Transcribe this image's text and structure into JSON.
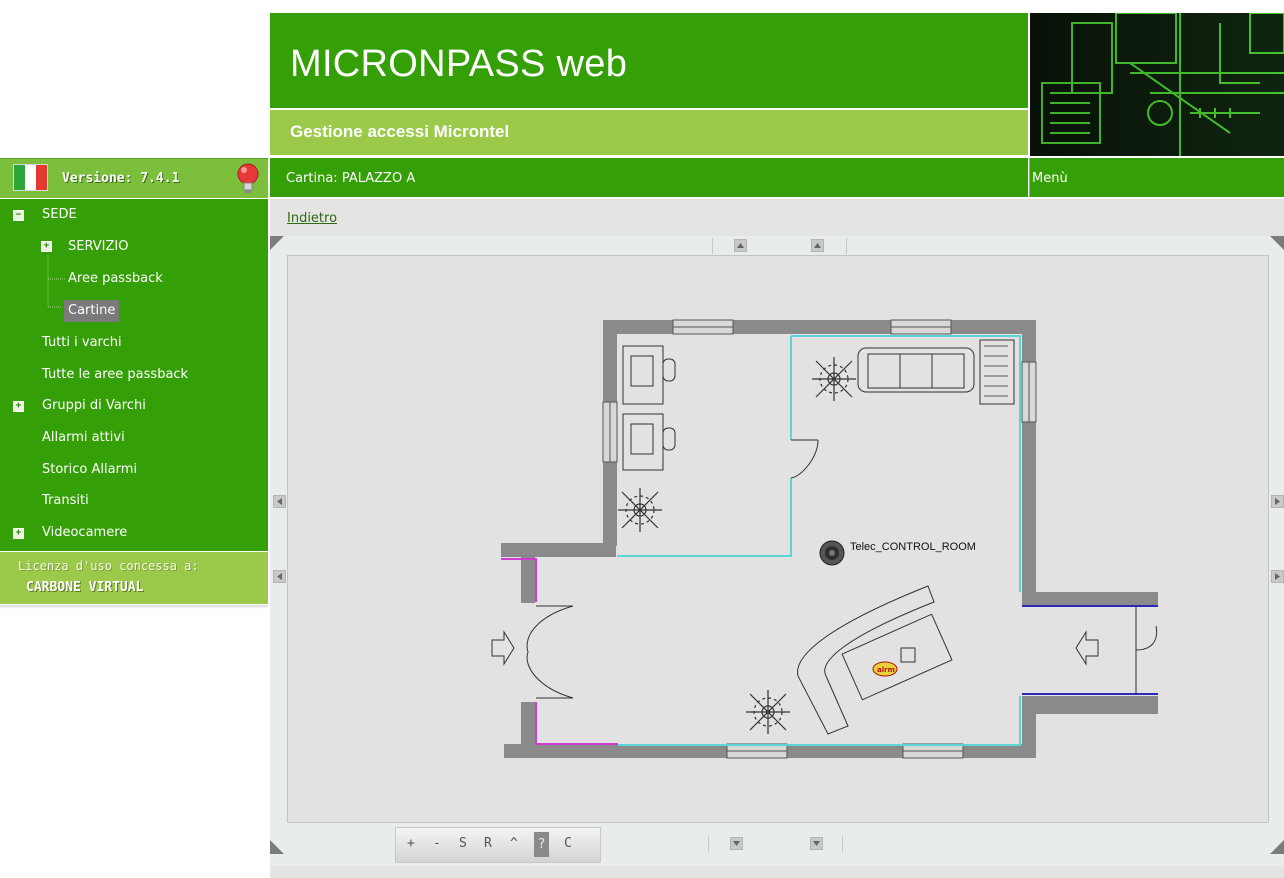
{
  "header": {
    "app_title": "MICRONPASS web",
    "app_subtitle": "Gestione accessi Microntel"
  },
  "version": {
    "label": "Versione: 7.4.1"
  },
  "map_header": {
    "title": "Cartina: PALAZZO A",
    "menu": "Menù"
  },
  "sidebar": {
    "items": [
      {
        "label": "SEDE",
        "expander": "−"
      },
      {
        "label": "SERVIZIO",
        "expander": "+"
      },
      {
        "label": "Aree passback"
      },
      {
        "label": "Cartine"
      },
      {
        "label": "Tutti i varchi"
      },
      {
        "label": "Tutte le aree passback"
      },
      {
        "label": "Gruppi di Varchi",
        "expander": "+"
      },
      {
        "label": "Allarmi attivi"
      },
      {
        "label": "Storico Allarmi"
      },
      {
        "label": "Transiti"
      },
      {
        "label": "Videocamere",
        "expander": "+"
      }
    ]
  },
  "license": {
    "label": "Licenza d'uso concessa a:",
    "holder": "CARBONE VIRTUAL"
  },
  "content": {
    "back_link": "Indietro"
  },
  "map": {
    "camera_label": "Telec_CONTROL_ROOM"
  },
  "toolbar": {
    "plus": "+",
    "minus": "-",
    "s": "S",
    "r": "R",
    "up": "^",
    "help": "?",
    "c": "C"
  },
  "colors": {
    "header_green": "#359f07",
    "light_green": "#9bc94a",
    "wall_gray": "#8a8a8a"
  }
}
